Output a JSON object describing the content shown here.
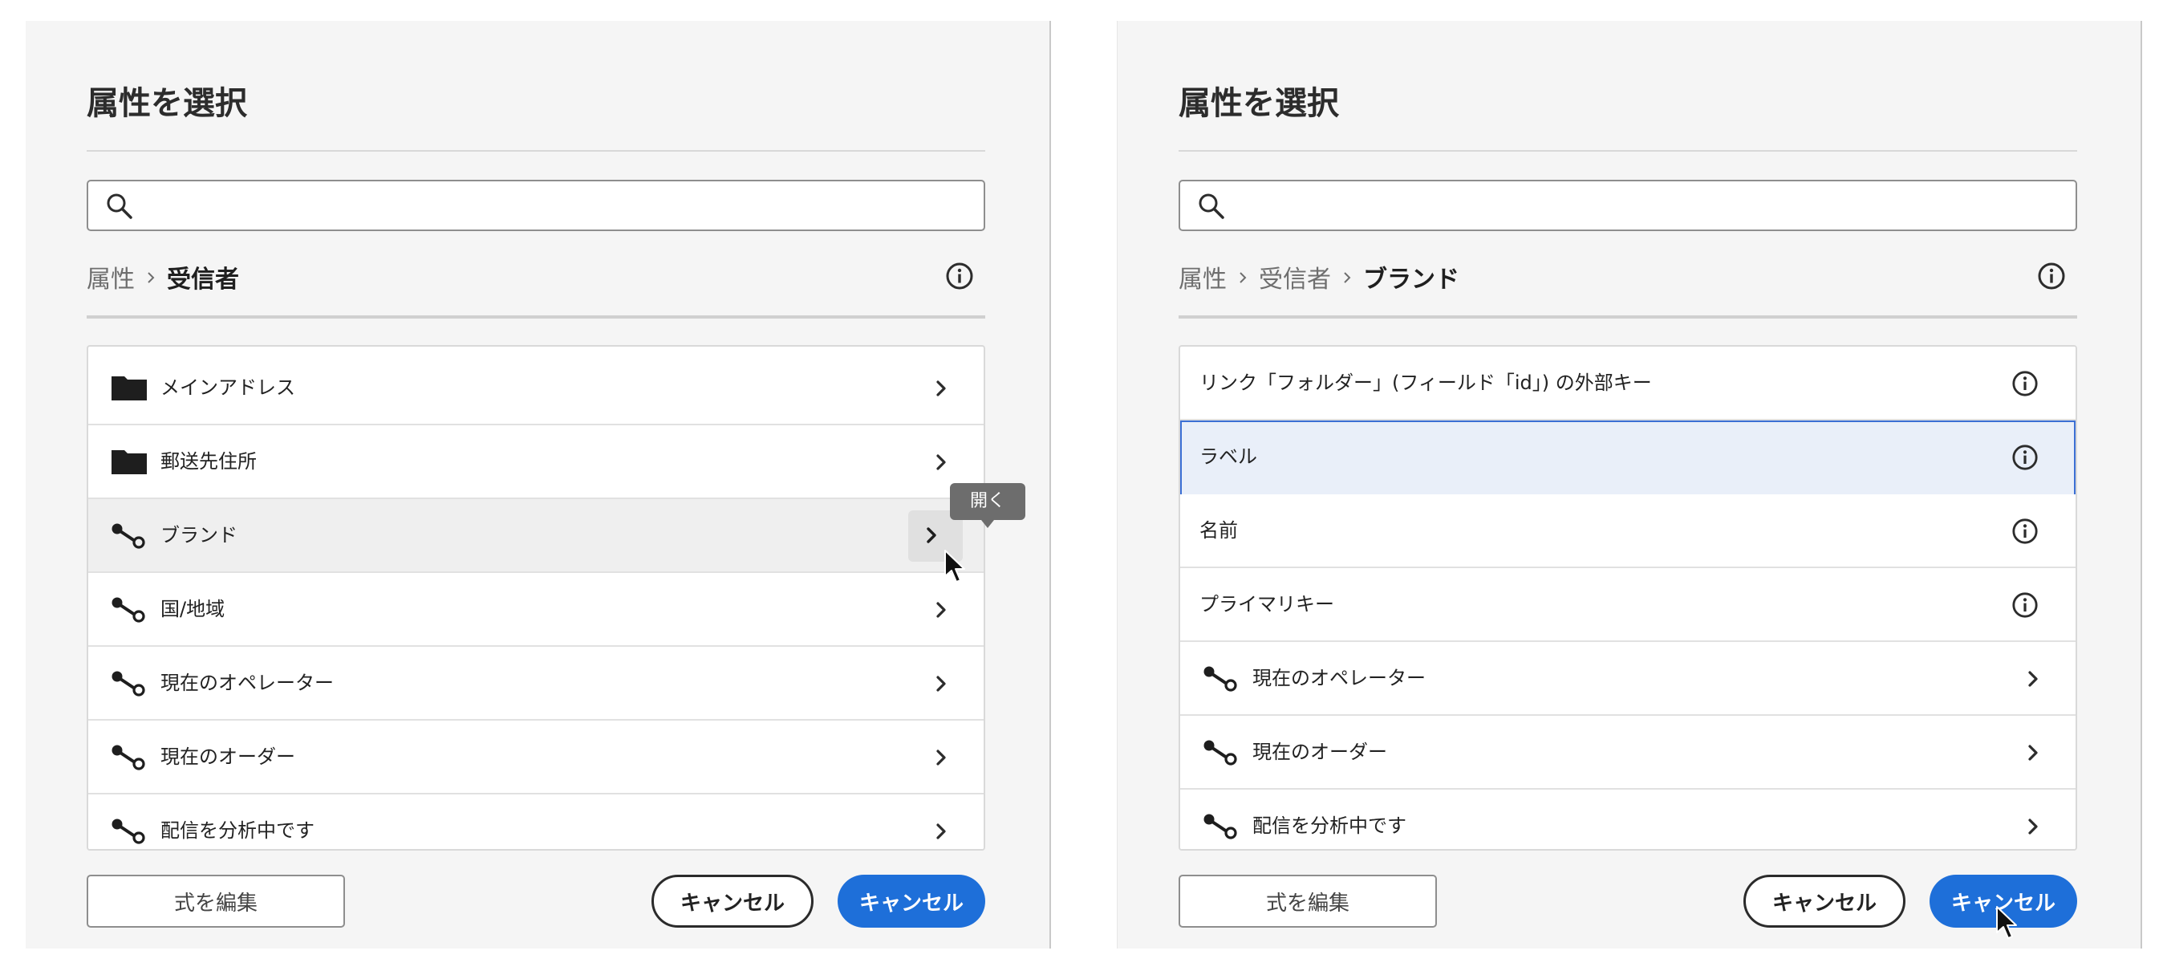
{
  "left_dialog": {
    "title": "属性を選択",
    "breadcrumb": [
      "属性",
      "受信者"
    ],
    "rows": [
      {
        "label": "メインアドレス",
        "icon": "folder-icon",
        "action": "chevron"
      },
      {
        "label": "郵送先住所",
        "icon": "folder-icon",
        "action": "chevron"
      },
      {
        "label": "ブランド",
        "icon": "link-icon",
        "action": "chevron"
      },
      {
        "label": "国/地域",
        "icon": "link-icon",
        "action": "chevron"
      },
      {
        "label": "現在のオペレーター",
        "icon": "link-icon",
        "action": "chevron"
      },
      {
        "label": "現在のオーダー",
        "icon": "link-icon",
        "action": "chevron"
      },
      {
        "label": "配信を分析中です",
        "icon": "link-icon",
        "action": "chevron"
      }
    ],
    "tooltip": "開く",
    "edit_expression_button": "式を編集",
    "cancel_button": "キャンセル",
    "primary_button": "キャンセル"
  },
  "right_dialog": {
    "title": "属性を選択",
    "breadcrumb": [
      "属性",
      "受信者",
      "ブランド"
    ],
    "rows": [
      {
        "label": "リンク「フォルダー」(フィールド「id」) の外部キー",
        "icon": "",
        "action": "info"
      },
      {
        "label": "ラベル",
        "icon": "",
        "action": "info"
      },
      {
        "label": "名前",
        "icon": "",
        "action": "info"
      },
      {
        "label": "プライマリキー",
        "icon": "",
        "action": "info"
      },
      {
        "label": "現在のオペレーター",
        "icon": "link-icon",
        "action": "chevron"
      },
      {
        "label": "現在のオーダー",
        "icon": "link-icon",
        "action": "chevron"
      },
      {
        "label": "配信を分析中です",
        "icon": "link-icon",
        "action": "chevron"
      }
    ],
    "edit_expression_button": "式を編集",
    "cancel_button": "キャンセル",
    "primary_button": "キャンセル"
  },
  "colors": {
    "accent": "#1e6fd9",
    "selected_row_bg": "#e9eff9",
    "selected_row_border": "#3b6fd4",
    "dialog_bg": "#f5f5f5"
  }
}
